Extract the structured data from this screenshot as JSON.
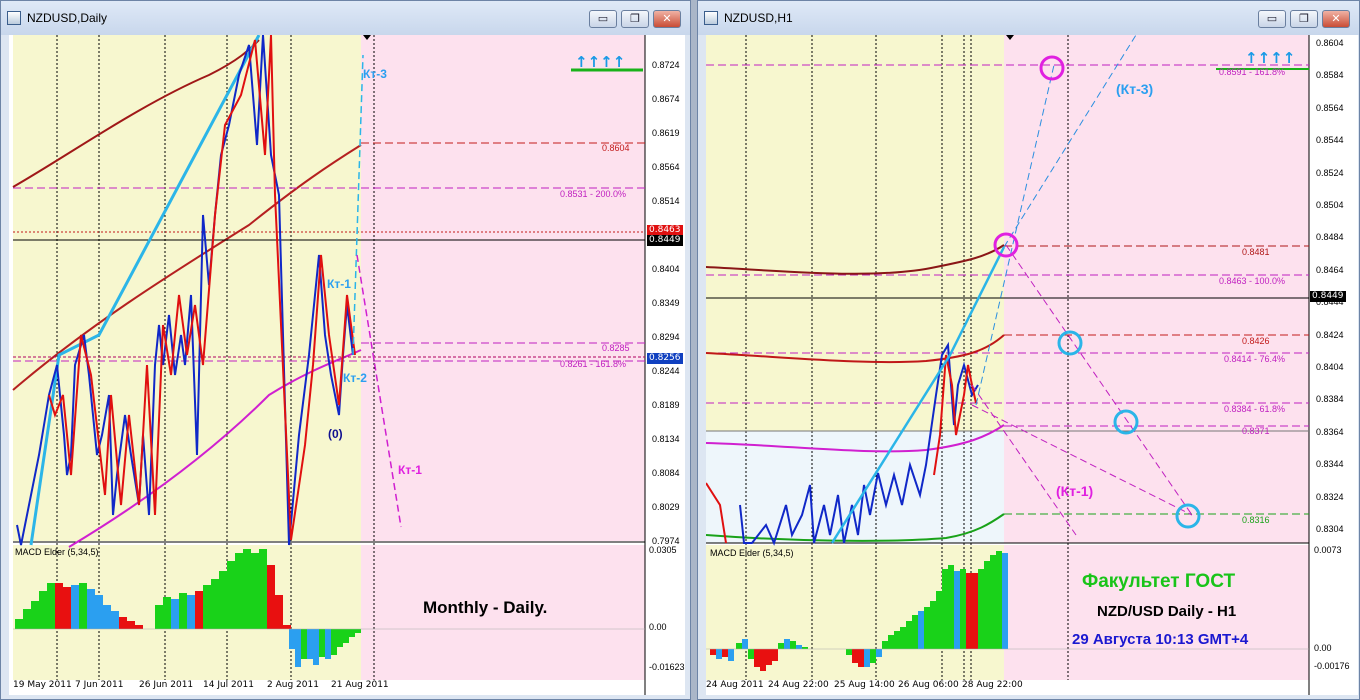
{
  "left_window": {
    "title": "NZDUSD,Daily",
    "buttons": {
      "minimize": "▭",
      "restore": "❐",
      "close": "✕"
    },
    "price_scale": [
      "0.8724",
      "0.8674",
      "0.8619",
      "0.8564",
      "0.8514",
      "0.8459",
      "0.8404",
      "0.8349",
      "0.8294",
      "0.8244",
      "0.8189",
      "0.8134",
      "0.8084",
      "0.8029",
      "0.7974"
    ],
    "price_tags": {
      "red": "0.8463",
      "black": "0.8449",
      "blue": "0.8256"
    },
    "levels": {
      "l1": "0.8604",
      "l2": "0.8531 - 200.0%",
      "l3": "0.8285",
      "l4": "0.8261 - 161.8%"
    },
    "annotations": {
      "kt3": "Кт-3",
      "kt1": "Кт-1",
      "kt2": "Кт-2",
      "zero": "(0)",
      "kt1_pink": "Кт-1"
    },
    "macd_title": "MACD Elder (5,34,5)",
    "macd_scale": [
      "0.0305",
      "0.00",
      "-0.01623"
    ],
    "overlay_text": "Monthly - Daily.",
    "dates": [
      "19 May 2011",
      "7 Jun 2011",
      "26 Jun 2011",
      "14 Jul 2011",
      "2 Aug 2011",
      "21 Aug 2011"
    ]
  },
  "right_window": {
    "title": "NZDUSD,H1",
    "buttons": {
      "minimize": "▭",
      "restore": "❐",
      "close": "✕"
    },
    "price_scale": [
      "0.8604",
      "0.8584",
      "0.8564",
      "0.8544",
      "0.8524",
      "0.8504",
      "0.8484",
      "0.8464",
      "0.8444",
      "0.8424",
      "0.8404",
      "0.8384",
      "0.8364",
      "0.8344",
      "0.8324",
      "0.8304"
    ],
    "price_tags": {
      "black": "0.8449"
    },
    "levels": {
      "l1": "0.8591 - 161.8%",
      "l2": "0.8481",
      "l3": "0.8463 - 100.0%",
      "l4": "0.8426",
      "l5": "0.8414 - 76.4%",
      "l6": "0.8384 - 61.8%",
      "l7": "0.8371",
      "l8": "0.8316"
    },
    "annotations": {
      "kt3": "(Кт-3)",
      "kt1": "(Кт-1)"
    },
    "macd_title": "MACD Elder (5,34,5)",
    "macd_scale": [
      "0.0073",
      "0.00",
      "-0.00176"
    ],
    "overlay": {
      "line1": "Факультет ГОСТ",
      "line2": "NZD/USD Daily - H1",
      "line3": "29 Августа 10:13 GMT+4"
    },
    "dates": [
      "24 Aug 2011",
      "24 Aug 22:00",
      "25 Aug 14:00",
      "26 Aug 06:00",
      "28 Aug 22:00"
    ]
  },
  "colors": {
    "yellow_bg": "#f7f7cf",
    "pink_bg": "#fde1ee",
    "lightblue_bg": "#eef6fb",
    "accent_blue": "#1a9ae6",
    "magenta": "#e020e0",
    "green_text": "#19c419",
    "navy_text": "#1a18d0"
  }
}
